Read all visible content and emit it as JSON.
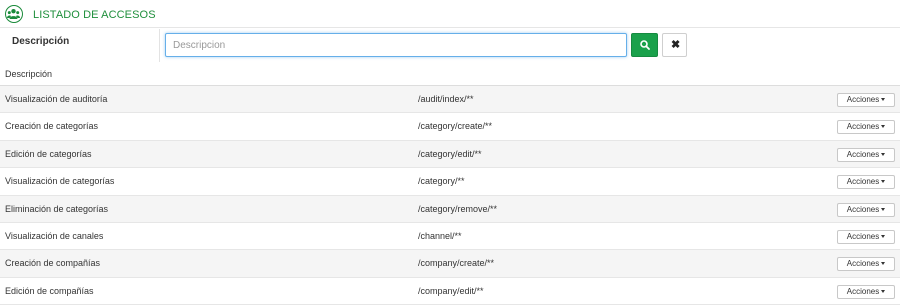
{
  "header": {
    "title": "LISTADO DE ACCESOS",
    "logo_icon": "users-group-icon",
    "brand_color": "#1f8f3c"
  },
  "filter": {
    "label": "Descripción",
    "search_placeholder": "Descripcion",
    "search_value": "",
    "search_icon": "search-icon",
    "clear_icon": "close-icon",
    "clear_label": "✖"
  },
  "table": {
    "column_header": "Descripción",
    "action_label": "Acciones",
    "rows": [
      {
        "description": "Visualización de auditoría",
        "path": "/audit/index/**"
      },
      {
        "description": "Creación de categorías",
        "path": "/category/create/**"
      },
      {
        "description": "Edición de categorías",
        "path": "/category/edit/**"
      },
      {
        "description": "Visualización de categorías",
        "path": "/category/**"
      },
      {
        "description": "Eliminación de categorías",
        "path": "/category/remove/**"
      },
      {
        "description": "Visualización de canales",
        "path": "/channel/**"
      },
      {
        "description": "Creación de compañías",
        "path": "/company/create/**"
      },
      {
        "description": "Edición de compañías",
        "path": "/company/edit/**"
      }
    ]
  }
}
